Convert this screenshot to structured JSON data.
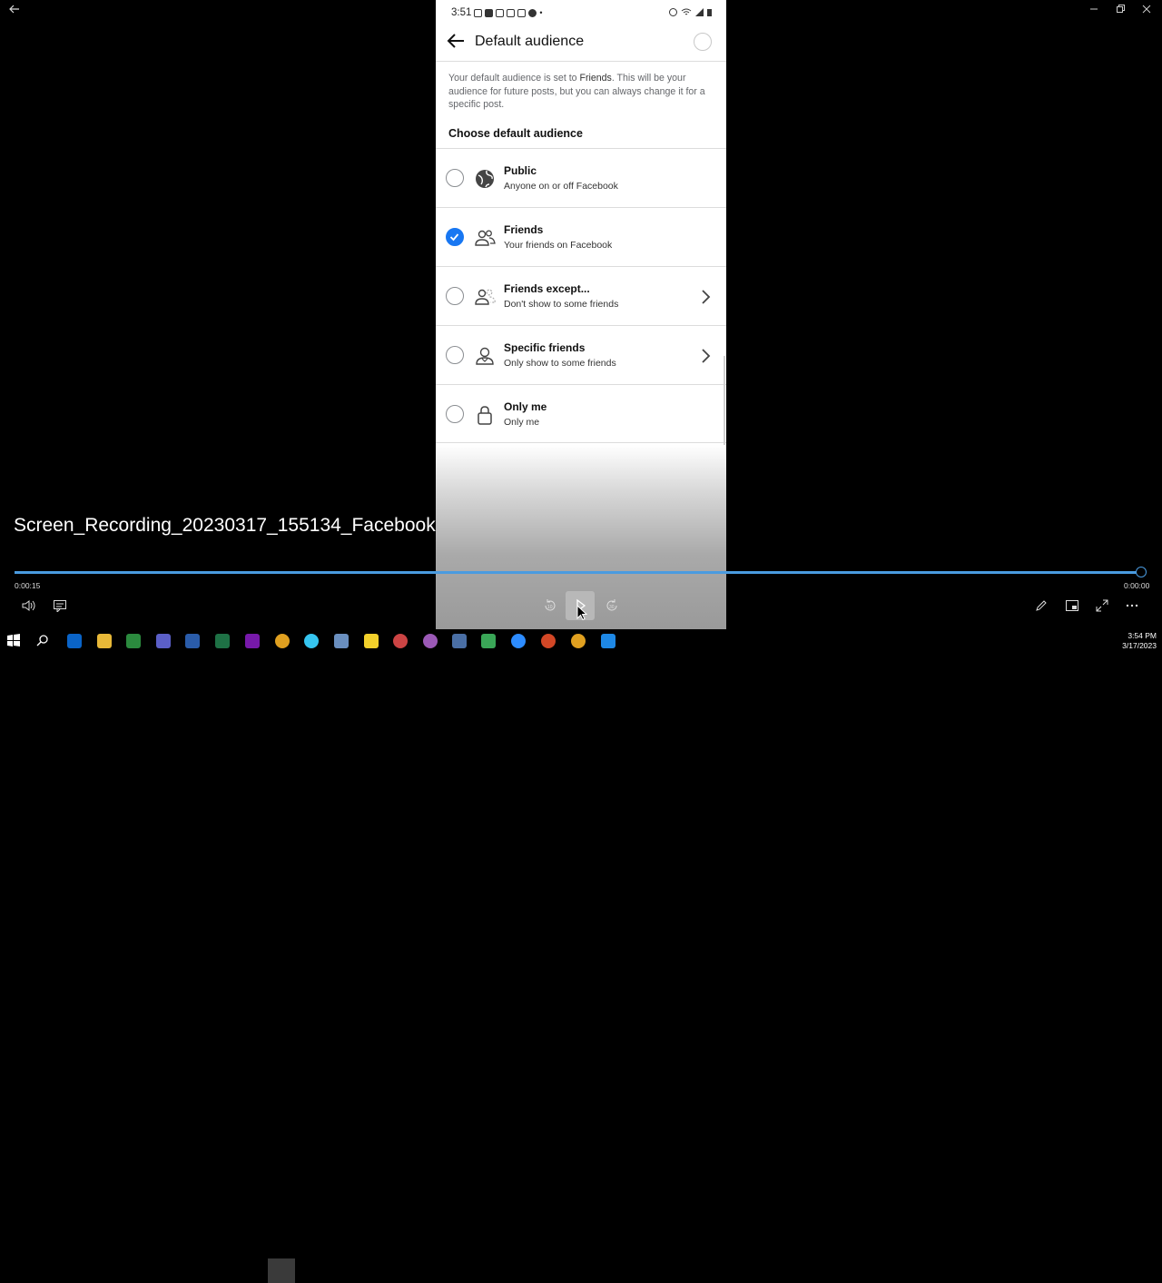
{
  "window": {
    "file_title": "Screen_Recording_20230317_155134_Facebook"
  },
  "phone": {
    "status_time": "3:51",
    "header_title": "Default audience",
    "description_pre": "Your default audience is set to ",
    "description_bold": "Friends",
    "description_post": ". This will be your audience for future posts, but you can always change it for a specific post.",
    "section_title": "Choose default audience",
    "options": [
      {
        "title": "Public",
        "subtitle": "Anyone on or off Facebook",
        "selected": false,
        "icon": "globe-icon"
      },
      {
        "title": "Friends",
        "subtitle": "Your friends on Facebook",
        "selected": true,
        "icon": "friends-icon"
      },
      {
        "title": "Friends except...",
        "subtitle": "Don't show to some friends",
        "selected": false,
        "icon": "friends-except-icon"
      },
      {
        "title": "Specific friends",
        "subtitle": "Only show to some friends",
        "selected": false,
        "icon": "specific-friend-icon"
      },
      {
        "title": "Only me",
        "subtitle": "Only me",
        "selected": false,
        "icon": "lock-icon"
      }
    ]
  },
  "player": {
    "elapsed": "0:00:15",
    "remaining": "0:00:00",
    "progress": 1.0,
    "accent": "#4a9be0"
  },
  "taskbar": {
    "time": "3:54 PM",
    "date": "3/17/2023"
  }
}
